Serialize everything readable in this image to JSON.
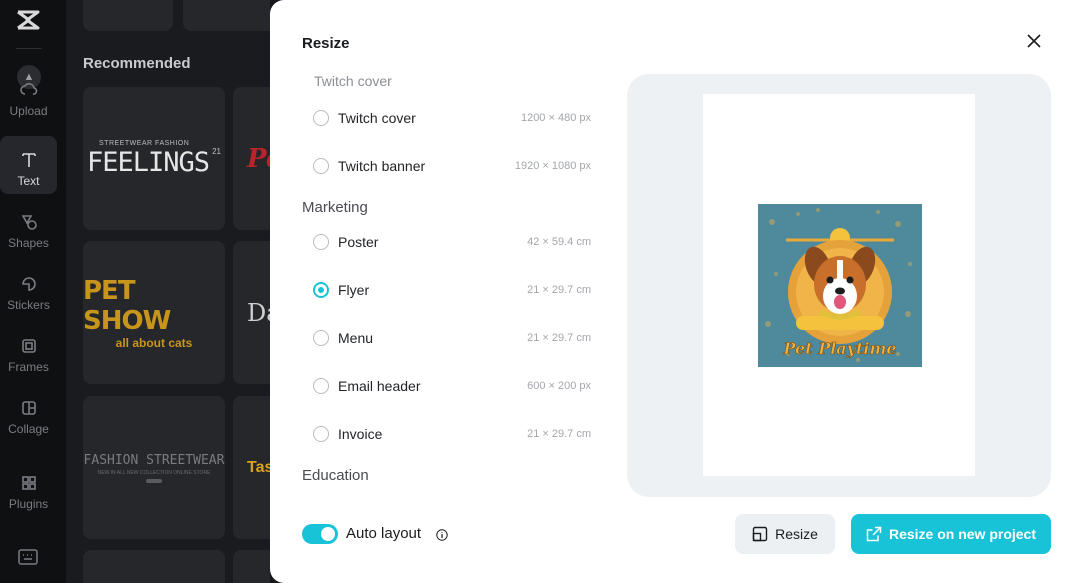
{
  "sidebar": {
    "items": [
      {
        "label": "Upload",
        "icon": "upload-icon"
      },
      {
        "label": "Text",
        "icon": "text-icon",
        "active": true
      },
      {
        "label": "Shapes",
        "icon": "shapes-icon"
      },
      {
        "label": "Stickers",
        "icon": "stickers-icon"
      },
      {
        "label": "Frames",
        "icon": "frames-icon"
      },
      {
        "label": "Collage",
        "icon": "collage-icon"
      },
      {
        "label": "Plugins",
        "icon": "plugins-icon"
      }
    ]
  },
  "panel": {
    "heading": "Recommended",
    "templates": [
      {
        "text_top": "STREETWEAR FASHION",
        "text_main": "FEELINGS",
        "badge": "21"
      },
      {
        "text_main": "PET SHOW",
        "text_sub": "all about cats"
      },
      {
        "text_main": "FASHION STREETWEAR",
        "text_sub": "NEW IN ALL NEW COLLECTION ONLINE STORE"
      },
      {
        "text_main": "Pe"
      },
      {
        "text_main": "Da"
      },
      {
        "text_main": "Tas"
      }
    ]
  },
  "modal": {
    "title": "Resize",
    "groups": {
      "partial_heading": "Twitch cover",
      "marketing": "Marketing",
      "education": "Education"
    },
    "options": [
      {
        "name": "Twitch cover",
        "size": "1200 × 480 px",
        "checked": false
      },
      {
        "name": "Twitch banner",
        "size": "1920 × 1080 px",
        "checked": false
      },
      {
        "name": "Poster",
        "size": "42 × 59.4 cm",
        "checked": false
      },
      {
        "name": "Flyer",
        "size": "21 × 29.7 cm",
        "checked": true
      },
      {
        "name": "Menu",
        "size": "21 × 29.7 cm",
        "checked": false
      },
      {
        "name": "Email header",
        "size": "600 × 200 px",
        "checked": false
      },
      {
        "name": "Invoice",
        "size": "21 × 29.7 cm",
        "checked": false
      }
    ],
    "auto_layout": {
      "label": "Auto layout",
      "enabled": true
    },
    "preview": {
      "artwork_text": "Pet Playtime"
    },
    "buttons": {
      "resize": "Resize",
      "resize_new": "Resize on new project"
    }
  },
  "colors": {
    "accent": "#19c3d7",
    "panel_bg": "#1a1b1e",
    "rail_bg": "#0f1012",
    "preview_bg": "#eef1f4"
  }
}
